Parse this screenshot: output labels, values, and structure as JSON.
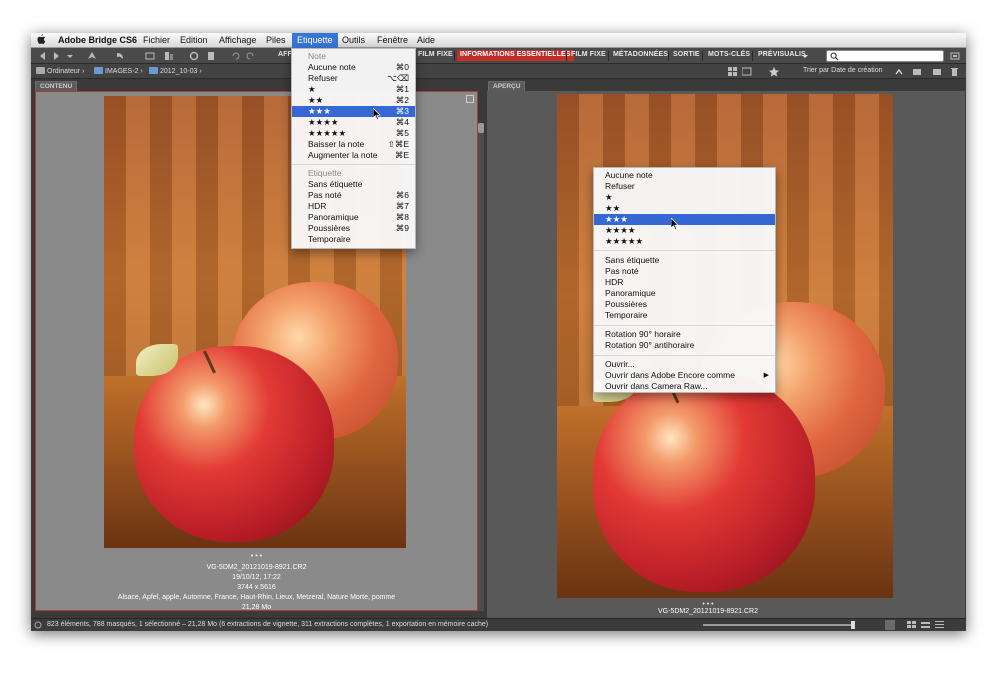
{
  "menubar": {
    "app_name": "Adobe Bridge CS6",
    "items": [
      "Fichier",
      "Edition",
      "Affichage",
      "Piles",
      "Etiquette",
      "Outils",
      "Fenêtre",
      "Aide"
    ],
    "active": "Etiquette"
  },
  "toolbar": {
    "workspaces": [
      "AFF",
      "FILM FIXE",
      "INFORMATIONS ESSENTIELLES",
      "FILM FIXE",
      "MÉTADONNÉES",
      "SORTIE",
      "MOTS-CLÉS",
      "PRÉVISUALIS"
    ],
    "active_workspace": "INFORMATIONS ESSENTIELLES",
    "search_placeholder": ""
  },
  "pathbar": {
    "crumbs": [
      "Ordinateur",
      "IMAGES-2",
      "2012_10-03"
    ],
    "sort_label": "Trier par Date de création"
  },
  "panels": {
    "left_tab": "CONTENU",
    "right_tab": "APERÇU"
  },
  "thumbnail": {
    "rating": "• • •",
    "filename": "VG-5DM2_20121019-8921.CR2",
    "date": "19/10/12, 17:22",
    "dimensions": "3744 x 5616",
    "keywords": "Alsace, Apfel, apple, Automne, France, Haut-Rhin, Lieux, Metzeral, Nature Morte, pomme",
    "size": "21,28 Mo"
  },
  "preview": {
    "rating": "• • •",
    "filename": "VG-5DM2_20121019-8921.CR2"
  },
  "label_menu": {
    "note_header": "Note",
    "note_items": [
      {
        "label": "Aucune note",
        "shortcut": "⌘0"
      },
      {
        "label": "Refuser",
        "shortcut": "⌥⌫"
      },
      {
        "label": "★",
        "shortcut": "⌘1"
      },
      {
        "label": "★★",
        "shortcut": "⌘2"
      },
      {
        "label": "★★★",
        "shortcut": "⌘3"
      },
      {
        "label": "★★★★",
        "shortcut": "⌘4"
      },
      {
        "label": "★★★★★",
        "shortcut": "⌘5"
      },
      {
        "label": "Baisser la note",
        "shortcut": "⇧⌘E"
      },
      {
        "label": "Augmenter la note",
        "shortcut": "⌘E"
      }
    ],
    "selected_index": 4,
    "label_header": "Etiquette",
    "label_items": [
      {
        "label": "Sans étiquette",
        "shortcut": ""
      },
      {
        "label": "Pas noté",
        "shortcut": "⌘6"
      },
      {
        "label": "HDR",
        "shortcut": "⌘7"
      },
      {
        "label": "Panoramique",
        "shortcut": "⌘8"
      },
      {
        "label": "Poussières",
        "shortcut": "⌘9"
      },
      {
        "label": "Temporaire",
        "shortcut": ""
      }
    ]
  },
  "context_menu": {
    "rating_items": [
      "Aucune note",
      "Refuser",
      "★",
      "★★",
      "★★★",
      "★★★★",
      "★★★★★"
    ],
    "selected_index": 4,
    "label_items": [
      "Sans étiquette",
      "Pas noté",
      "HDR",
      "Panoramique",
      "Poussières",
      "Temporaire"
    ],
    "rotation_items": [
      "Rotation 90° horaire",
      "Rotation 90° antihoraire"
    ],
    "open_items": [
      "Ouvrir...",
      "Ouvrir dans Adobe Encore comme",
      "Ouvrir dans Camera Raw..."
    ]
  },
  "status": {
    "text": "823 éléments, 788 masqués, 1 sélectionné – 21,28 Mo (6 extractions de vignette, 311 extractions complètes, 1 exportation en mémoire cache)"
  }
}
